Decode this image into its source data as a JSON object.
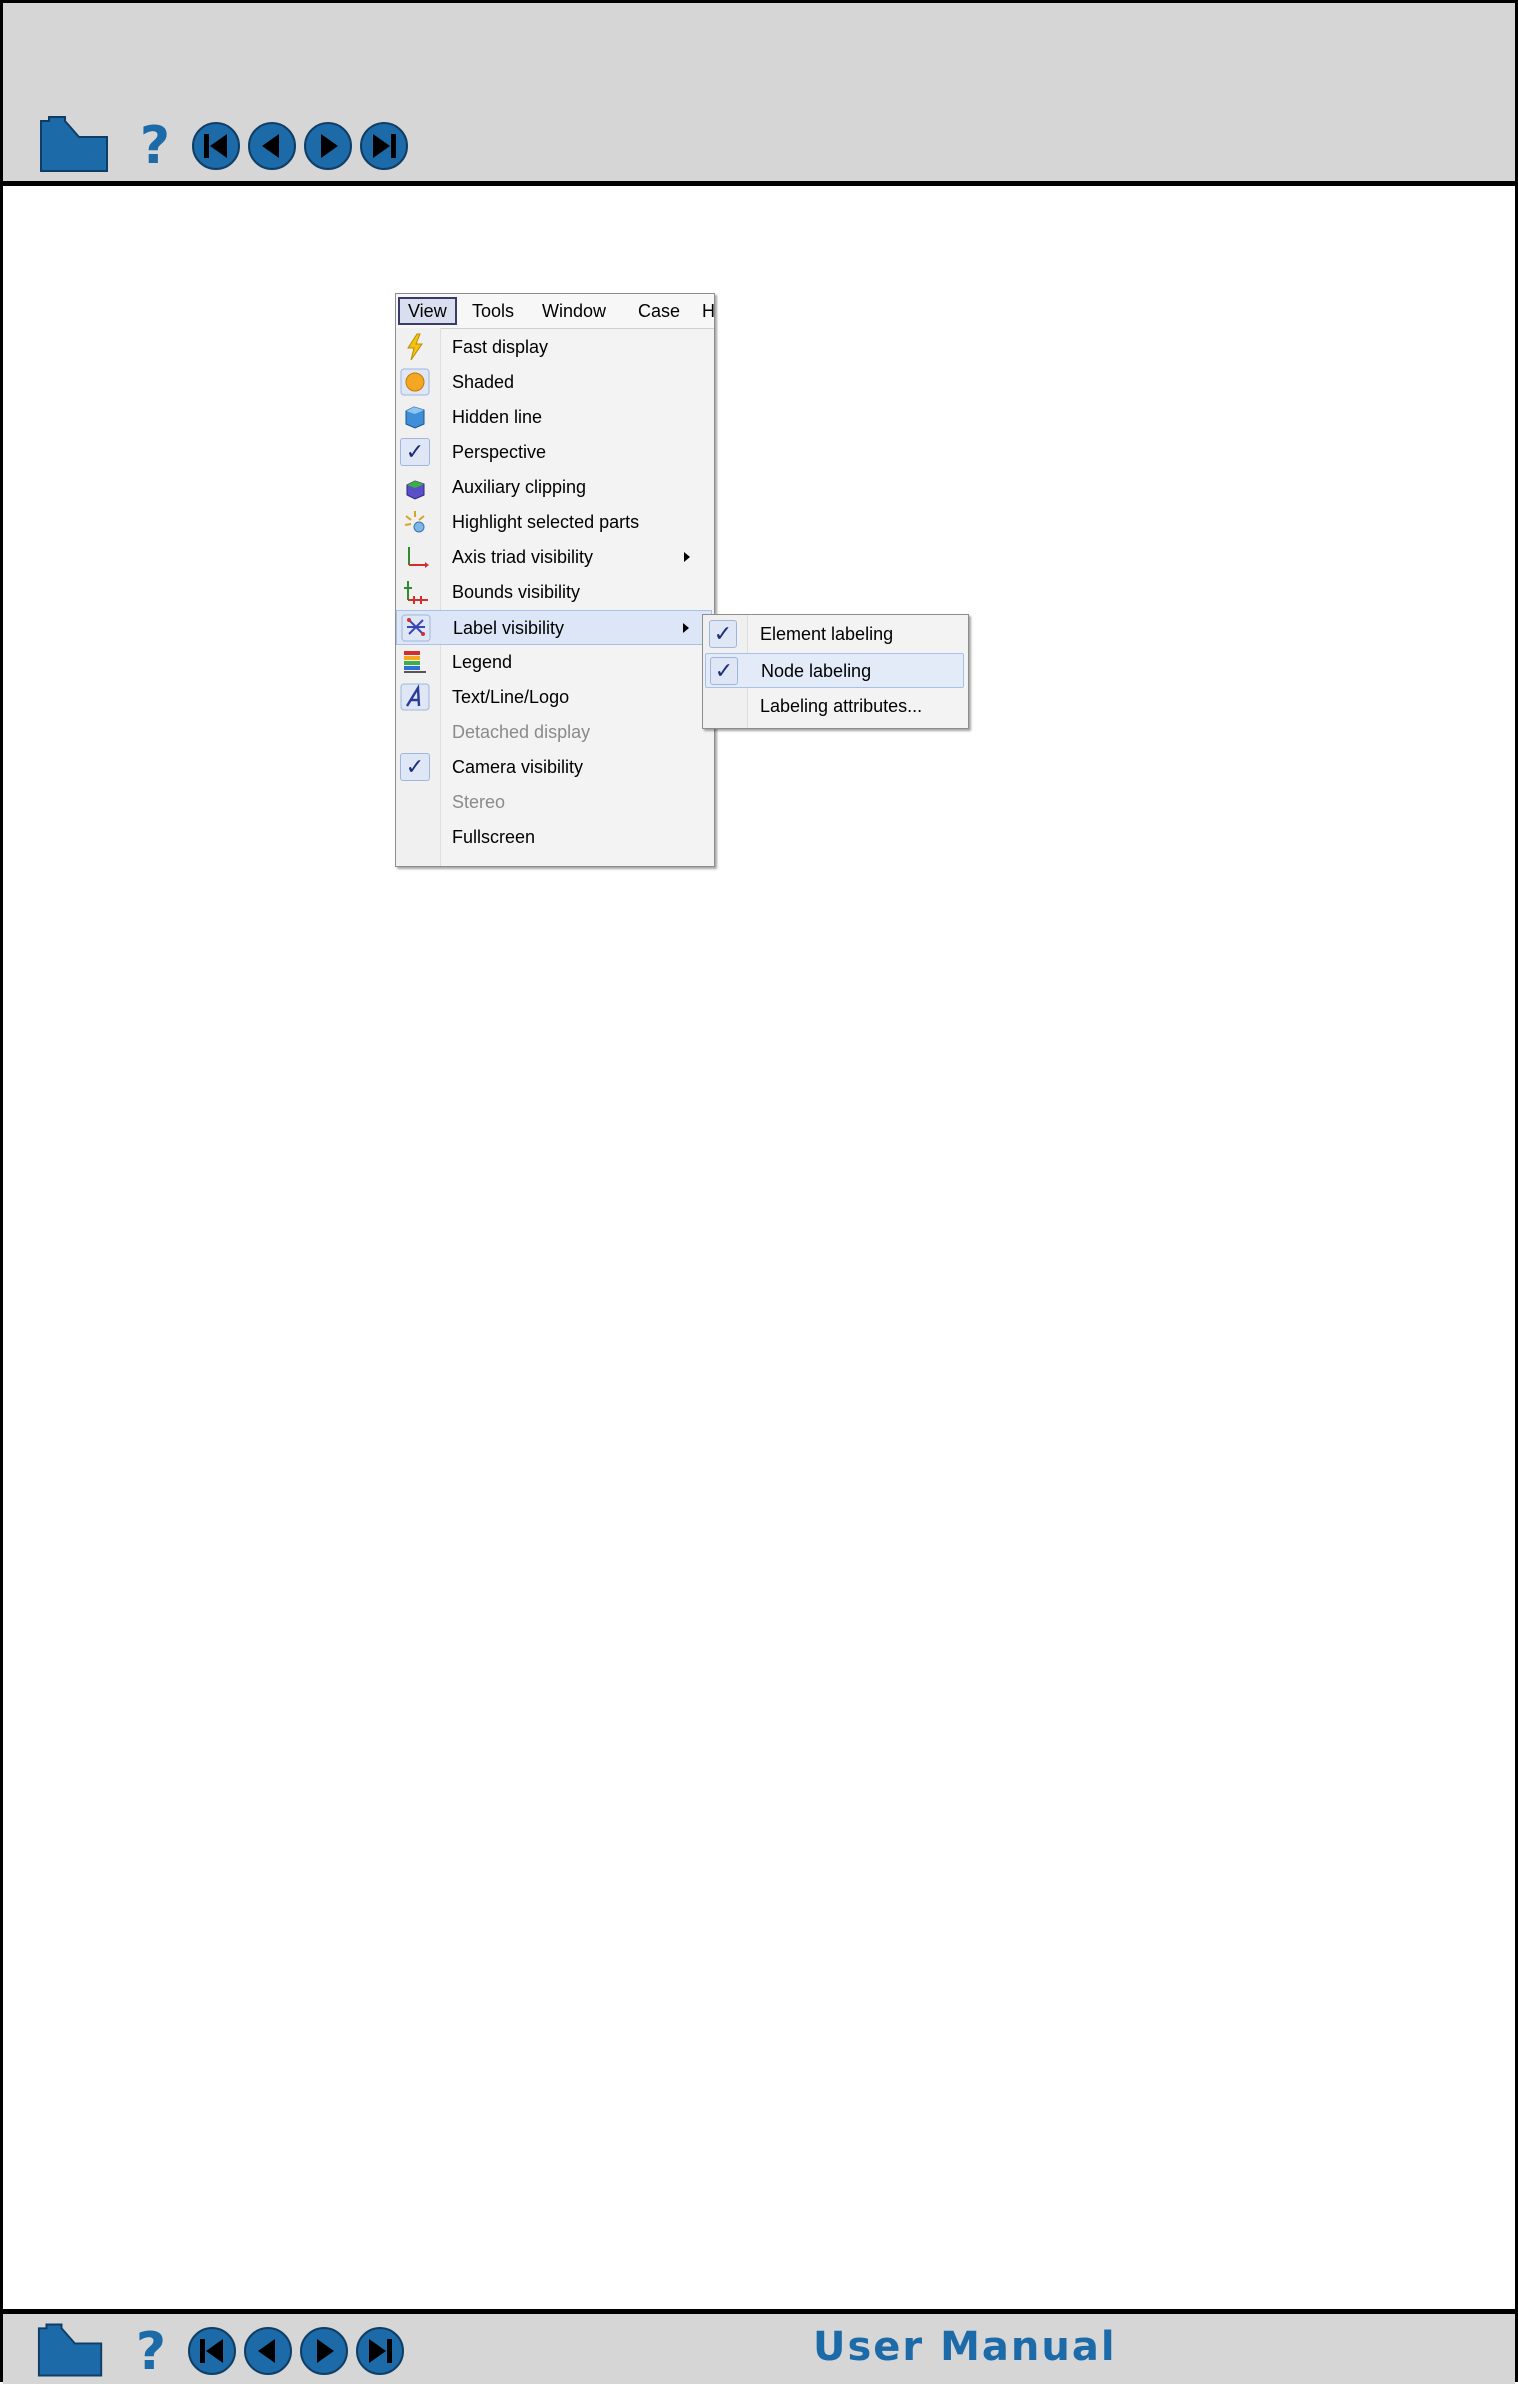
{
  "menubar": {
    "items": [
      "View",
      "Tools",
      "Window",
      "Case",
      "H"
    ]
  },
  "view_menu": {
    "items": [
      {
        "label": "Fast display",
        "icon": "lightning-icon"
      },
      {
        "label": "Shaded",
        "icon": "shaded-sphere-icon"
      },
      {
        "label": "Hidden line",
        "icon": "hidden-line-cube-icon"
      },
      {
        "label": "Perspective",
        "icon": "checkmark-icon",
        "checked": true
      },
      {
        "label": "Auxiliary clipping",
        "icon": "auxiliary-clipping-icon"
      },
      {
        "label": "Highlight selected parts",
        "icon": "highlight-parts-icon"
      },
      {
        "label": "Axis triad visibility",
        "icon": "axis-triad-icon",
        "submenu": true
      },
      {
        "label": "Bounds visibility",
        "icon": "bounds-icon"
      },
      {
        "label": "Label visibility",
        "icon": "label-visibility-icon",
        "submenu": true,
        "highlighted": true
      },
      {
        "label": "Legend",
        "icon": "legend-icon"
      },
      {
        "label": "Text/Line/Logo",
        "icon": "text-line-logo-icon"
      },
      {
        "label": "Detached display",
        "disabled": true
      },
      {
        "label": "Camera visibility",
        "icon": "checkmark-icon",
        "checked": true
      },
      {
        "label": "Stereo",
        "disabled": true
      },
      {
        "label": "Fullscreen"
      }
    ]
  },
  "label_submenu": {
    "items": [
      {
        "label": "Element labeling",
        "checked": true
      },
      {
        "label": "Node labeling",
        "checked": true,
        "highlighted": true
      },
      {
        "label": "Labeling attributes..."
      }
    ]
  },
  "footer": {
    "title": "User Manual"
  },
  "colors": {
    "nav_blue": "#1c6aa8",
    "bar_gray": "#d6d6d6",
    "highlight": "#dde6f7",
    "check_navy": "#1c2e7a"
  }
}
